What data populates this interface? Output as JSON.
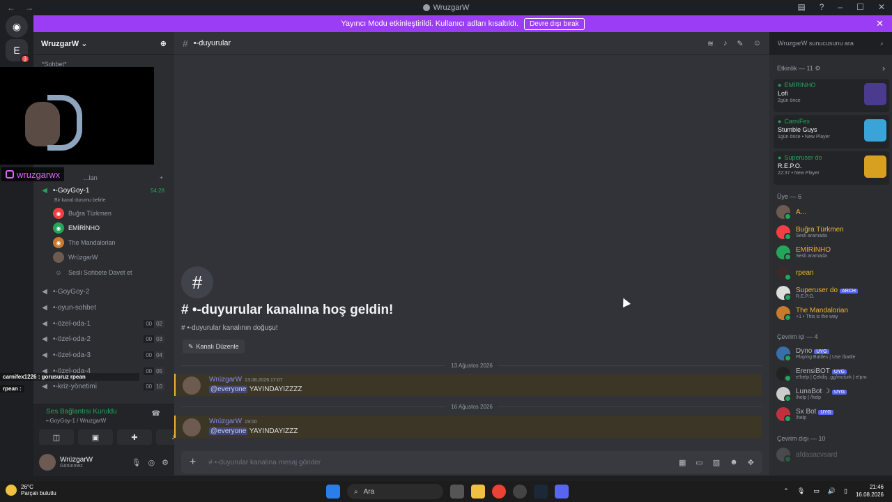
{
  "titlebar": {
    "title": "WruzgarW",
    "back": "←",
    "forward": "→",
    "min": "–",
    "max": "☐",
    "close": "✕"
  },
  "banner": {
    "text": "Yayıncı Modu etkinleştirildi. Kullanıcı adları kısaltıldı.",
    "button": "Devre dışı bırak"
  },
  "guilds": [
    {
      "label": "◉"
    },
    {
      "label": "E",
      "badge": "3"
    }
  ],
  "server": {
    "name": "WruzgarW",
    "category_top": "*Sohbet*",
    "category_voice": "...ları"
  },
  "overlay": {
    "instagram": "wruzgarwx",
    "chat": [
      "carnifex1226 : gorusuruz rpean",
      "rpean :"
    ]
  },
  "channels": [
    {
      "name": "•-GoyGoy-1",
      "timer": "54:28",
      "status": "Bir kanal durumu belirle"
    },
    {
      "name": "•-GoyGoy-2"
    },
    {
      "name": "•-oyun-sohbet"
    },
    {
      "name": "•-özel-oda-1",
      "c1": "00",
      "c2": "02"
    },
    {
      "name": "•-özel-oda-2",
      "c1": "00",
      "c2": "03"
    },
    {
      "name": "•-özel-oda-3",
      "c1": "00",
      "c2": "04"
    },
    {
      "name": "•-özel-oda-4",
      "c1": "00",
      "c2": "05"
    },
    {
      "name": "•-kriz-yönetimi",
      "c1": "00",
      "c2": "10"
    }
  ],
  "voice_users": [
    "Buğra Türkmen",
    "EMİRİNHO",
    "The Mandalorian",
    "WrüzgarW",
    "Sesli Sohbete Davet et"
  ],
  "voicebar": {
    "status": "Ses Bağlantısı Kuruldu",
    "sub": "•-GoyGoy-1 / WruzgarW"
  },
  "user": {
    "name": "WrüzgarW",
    "status": "Görünmez"
  },
  "channel": {
    "name": "•-duyurular",
    "search": "WruzgarW sunucusunu ara"
  },
  "welcome": {
    "title": "# •-duyurular kanalına hoş geldin!",
    "sub": "# •-duyurular kanalının doğuşu!",
    "edit": "Kanalı Düzenle"
  },
  "messages": [
    {
      "date": "13 Ağustos 2026",
      "author": "WrüzgarW",
      "time": "13.08.2026 17:07",
      "mention": "@everyone",
      "text": "YAYINDAYIZZZZ"
    },
    {
      "date": "16 Ağustos 2026",
      "author": "WrüzgarW",
      "time": "19:00",
      "mention": "@everyone",
      "text": "YAYINDAYIZZZ"
    }
  ],
  "composer": {
    "placeholder": "# •-duyurular kanalına mesaj gönder"
  },
  "activity": {
    "header": "Etkinlik — 11",
    "items": [
      {
        "who": "EMİRİNHO",
        "game": "Lofi",
        "meta": "2gün önce",
        "thumb": "#4a3b8f"
      },
      {
        "who": "CarniFex",
        "game": "Stumble Guys",
        "meta": "1gün önce • New Player",
        "thumb": "#3aa4d8"
      },
      {
        "who": "Superuser do",
        "game": "R.E.P.O.",
        "meta": "22:37 • New Player",
        "thumb": "#d8a020"
      }
    ]
  },
  "members": {
    "header_members": "Üye — 6",
    "list": [
      {
        "name": "A...",
        "sub": ""
      },
      {
        "name": "Buğra Türkmen",
        "sub": "Sesli aramada"
      },
      {
        "name": "EMİRİNHO",
        "sub": "Sesli aramada"
      },
      {
        "name": "rpean",
        "sub": ""
      },
      {
        "name": "Superuser do",
        "sub": "R.E.P.O.",
        "tag": "ARCH"
      },
      {
        "name": "The Mandalorian",
        "sub": "+1 • This is the way"
      }
    ],
    "header_online": "Çevrim içi — 4",
    "bots": [
      {
        "name": "Dyno",
        "sub": "Playing Battles | Use /battle"
      },
      {
        "name": "ErensiBOT",
        "sub": "e!help | Çekiliş .gg/mcturk | e!pro"
      },
      {
        "name": "LunaBot",
        "sub": "/help | /help"
      },
      {
        "name": "Sx Bot",
        "sub": "/help"
      }
    ],
    "bot_tag": "UYG",
    "header_offline": "Çevrim dışı — 10",
    "offline": [
      "afdasacvsard"
    ]
  },
  "taskbar": {
    "temp": "26°C",
    "weather": "Parçalı bulutlu",
    "search": "Ara",
    "time": "21:46",
    "date": "16.08.2026"
  },
  "colors": {
    "accent": "#5865f2",
    "banner": "#9b3df5",
    "online": "#23a55a",
    "mention_bg": "#3c3627"
  }
}
